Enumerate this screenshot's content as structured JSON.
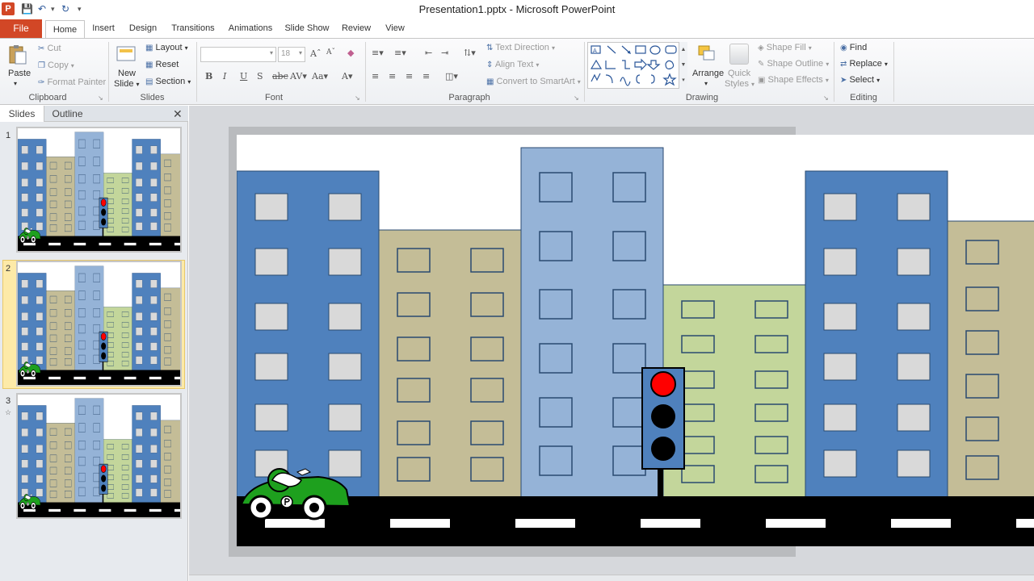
{
  "window": {
    "title": "Presentation1.pptx - Microsoft PowerPoint",
    "app_icon_letter": "P"
  },
  "ribbon_tabs": [
    "File",
    "Home",
    "Insert",
    "Design",
    "Transitions",
    "Animations",
    "Slide Show",
    "Review",
    "View"
  ],
  "active_tab": "Home",
  "clipboard": {
    "paste": "Paste",
    "cut": "Cut",
    "copy": "Copy",
    "format_painter": "Format Painter",
    "group": "Clipboard"
  },
  "slides_group": {
    "new_slide_1": "New",
    "new_slide_2": "Slide",
    "layout": "Layout",
    "reset": "Reset",
    "section": "Section",
    "group": "Slides"
  },
  "font": {
    "family_value": "",
    "size_value": "18",
    "group": "Font"
  },
  "paragraph": {
    "text_direction": "Text Direction",
    "align_text": "Align Text",
    "convert_smartart": "Convert to SmartArt",
    "group": "Paragraph"
  },
  "drawing": {
    "arrange": "Arrange",
    "quick_1": "Quick",
    "quick_2": "Styles",
    "shape_fill": "Shape Fill",
    "shape_outline": "Shape Outline",
    "shape_effects": "Shape Effects",
    "group": "Drawing"
  },
  "editing": {
    "find": "Find",
    "replace": "Replace",
    "select": "Select",
    "group": "Editing"
  },
  "left_pane": {
    "tabs": [
      "Slides",
      "Outline"
    ],
    "slide_numbers": [
      "1",
      "2",
      "3"
    ],
    "selected_slide": 2
  },
  "colors": {
    "file_tab": "#d24726",
    "blue_building": "#4f81bd",
    "light_blue_building": "#95b3d7",
    "tan_building": "#c4bd97",
    "green_building": "#c3d69b",
    "window_gray": "#d9d9d9",
    "road": "#000000",
    "red_light": "#ff0000",
    "car_green": "#1ea01e"
  }
}
